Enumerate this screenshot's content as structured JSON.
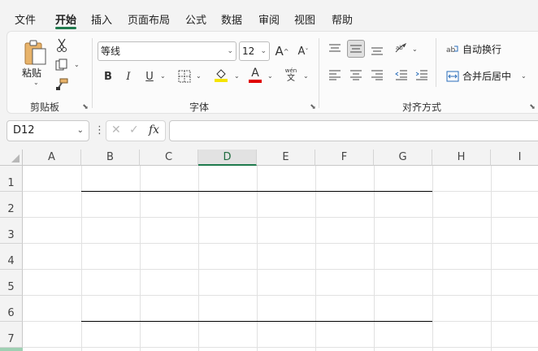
{
  "menu": {
    "items": [
      "文件",
      "开始",
      "插入",
      "页面布局",
      "公式",
      "数据",
      "审阅",
      "视图",
      "帮助"
    ],
    "active": "开始"
  },
  "clipboard": {
    "paste_label": "粘贴",
    "group_label": "剪贴板"
  },
  "font": {
    "font_name": "等线",
    "font_size": "12",
    "group_label": "字体",
    "bold": "B",
    "italic": "I",
    "underline": "U",
    "grow": "A",
    "shrink": "A",
    "font_color_letter": "A",
    "phonetic_top": "wén",
    "phonetic_bottom": "文",
    "fill_color": "#f5e400",
    "font_color": "#e00000"
  },
  "alignment": {
    "wrap_text": "自动换行",
    "merge_center": "合并后居中",
    "group_label": "对齐方式"
  },
  "formula_bar": {
    "name_box": "D12",
    "fx": "fx",
    "formula": ""
  },
  "sheet": {
    "columns": [
      "A",
      "B",
      "C",
      "D",
      "E",
      "F",
      "G",
      "H",
      "I"
    ],
    "selected_column": "D",
    "rows": [
      "1",
      "2",
      "3",
      "4",
      "5",
      "6",
      "7"
    ],
    "accent": "#1f7a4d"
  }
}
